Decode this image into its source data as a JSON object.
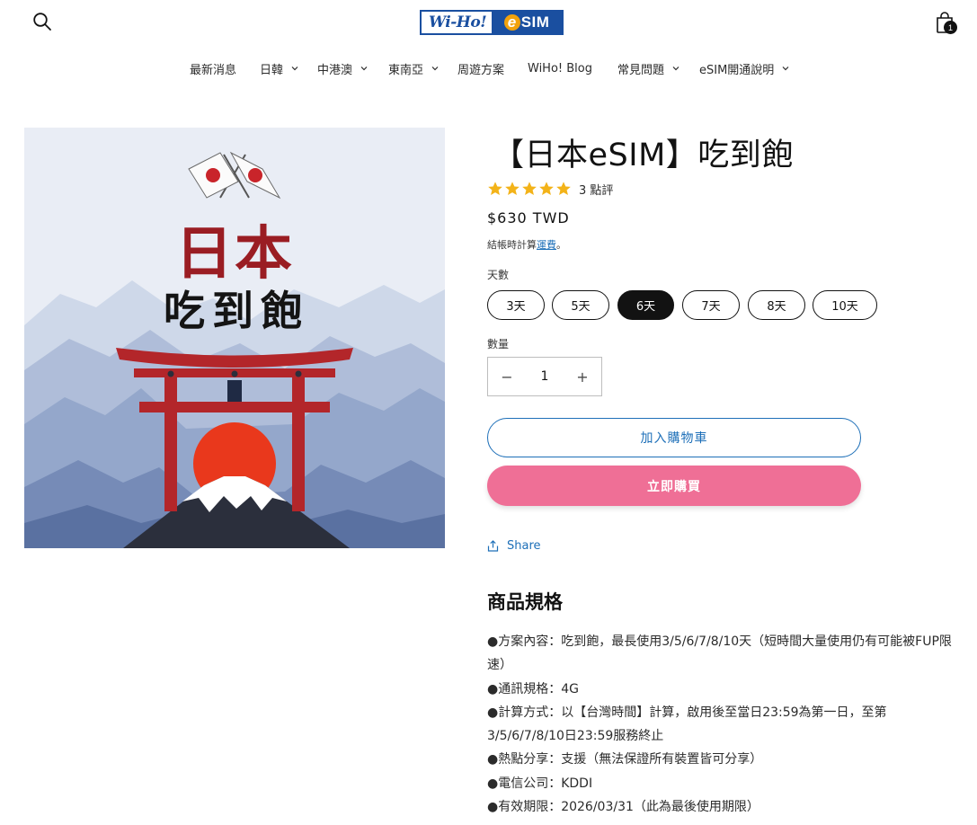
{
  "header": {
    "logo_text_left": "Wi-Ho!",
    "logo_text_e": "e",
    "logo_text_sim": "SIM",
    "cart_count": "1"
  },
  "nav": [
    {
      "label": "最新消息",
      "has_dropdown": false
    },
    {
      "label": "日韓",
      "has_dropdown": true
    },
    {
      "label": "中港澳",
      "has_dropdown": true
    },
    {
      "label": "東南亞",
      "has_dropdown": true
    },
    {
      "label": "周遊方案",
      "has_dropdown": false
    },
    {
      "label": "WiHo! Blog",
      "has_dropdown": false
    },
    {
      "label": "常見問題",
      "has_dropdown": true
    },
    {
      "label": "eSIM開通說明",
      "has_dropdown": true
    }
  ],
  "product_image": {
    "line1": "日本",
    "line2": "吃到飽"
  },
  "product": {
    "title": "【日本eSIM】吃到飽",
    "rating_stars": 5,
    "rating_count": "3 點評",
    "price": "$630 TWD",
    "tax_note_prefix": "結帳時計算",
    "tax_note_link": "運費",
    "tax_note_suffix": "。",
    "days_label": "天數",
    "day_options": [
      "3天",
      "5天",
      "6天",
      "7天",
      "8天",
      "10天"
    ],
    "selected_day": "6天",
    "quantity_label": "數量",
    "quantity_value": "1",
    "minus_label": "−",
    "plus_label": "+",
    "add_to_cart": "加入購物車",
    "buy_now": "立即購買",
    "share": "Share"
  },
  "specs": {
    "title": "商品規格",
    "items": [
      "●方案內容：吃到飽，最長使用3/5/6/7/8/10天（短時間大量使用仍有可能被FUP限速）",
      "●通訊規格：4G",
      "●計算方式：以【台灣時間】計算，啟用後至當日23:59為第一日，至第3/5/6/7/8/10日23:59服務終止",
      "●熱點分享：支援（無法保證所有裝置皆可分享）",
      "●電信公司：KDDI",
      "●有效期限：2026/03/31（此為最後使用期限）"
    ]
  },
  "colors": {
    "accent_blue": "#1d6fb8",
    "buy_pink": "#ef6f96",
    "star_gold": "#f3b319",
    "torii_red": "#b3262a"
  }
}
